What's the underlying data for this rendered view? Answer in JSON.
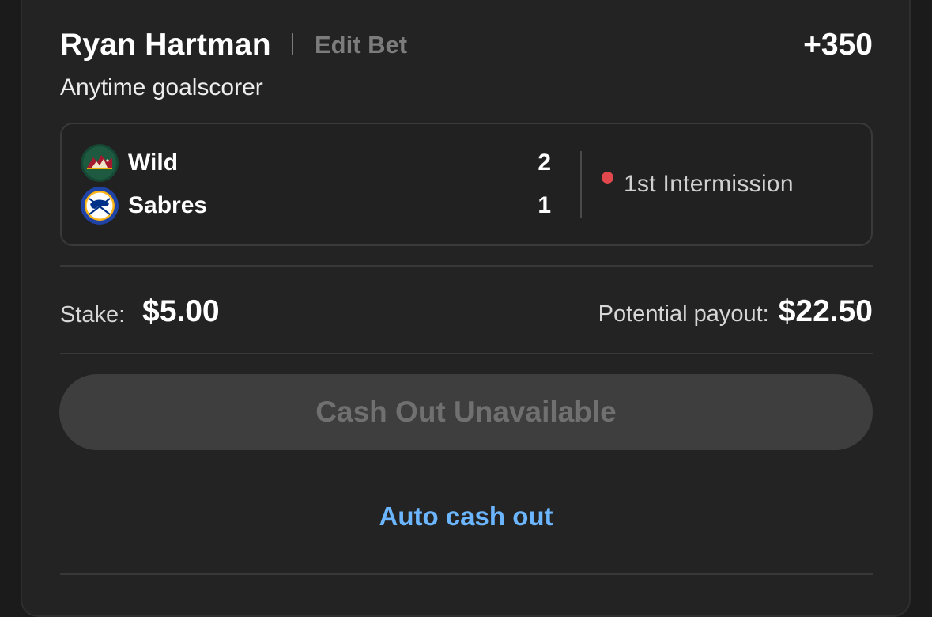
{
  "bet": {
    "player_name": "Ryan Hartman",
    "edit_label": "Edit Bet",
    "odds": "+350",
    "market": "Anytime goalscorer"
  },
  "game": {
    "teams": [
      {
        "name": "Wild",
        "score": "2",
        "logo_icon": "minnesota-wild-logo",
        "logo_color": "#154734"
      },
      {
        "name": "Sabres",
        "score": "1",
        "logo_icon": "buffalo-sabres-logo",
        "logo_color": "#1f44a6"
      }
    ],
    "status": "1st Intermission",
    "status_color": "#e0484d"
  },
  "wager": {
    "stake_label": "Stake:",
    "stake_value": "$5.00",
    "payout_label": "Potential payout:",
    "payout_value": "$22.50"
  },
  "actions": {
    "cashout_label": "Cash Out Unavailable",
    "auto_cashout_label": "Auto cash out",
    "link_color": "#6bb6ff"
  }
}
